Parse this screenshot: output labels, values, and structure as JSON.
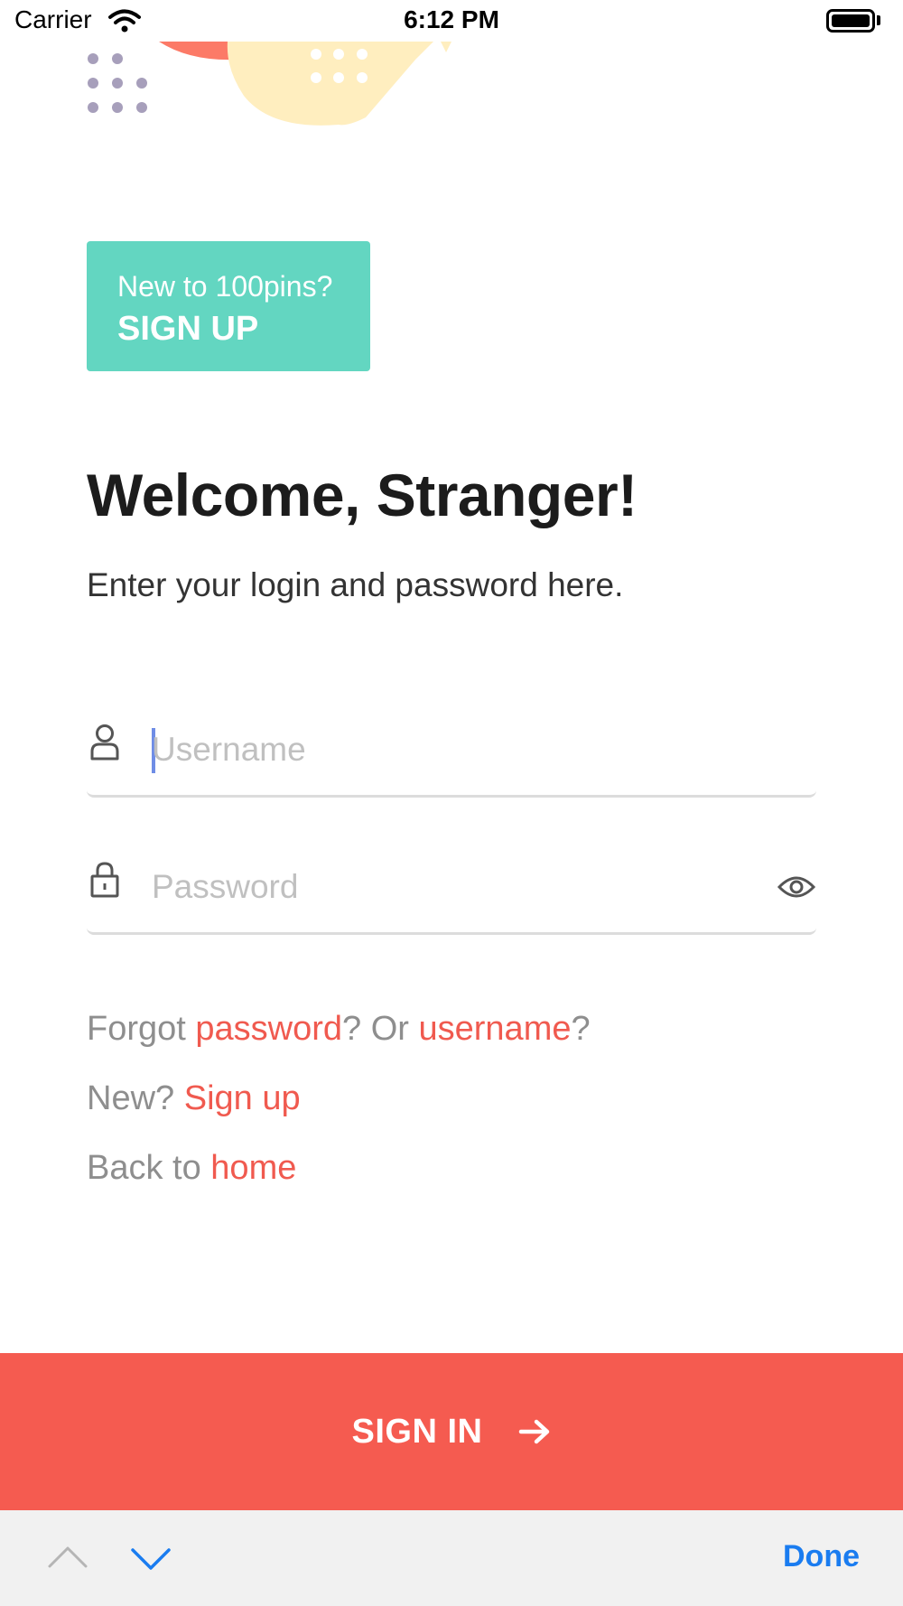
{
  "status_bar": {
    "carrier": "Carrier",
    "time": "6:12 PM",
    "icons": [
      "wifi-icon",
      "battery-icon"
    ]
  },
  "colors": {
    "accent_red": "#f55b50",
    "teal": "#63d6c1",
    "link_red": "#f05a4f",
    "toolbar_blue": "#1a7cf0"
  },
  "signup_card": {
    "prompt": "New to 100pins?",
    "cta": "SIGN UP"
  },
  "welcome": {
    "title": "Welcome, Stranger!",
    "subtitle": "Enter your login and password here."
  },
  "form": {
    "username": {
      "placeholder": "Username",
      "value": "",
      "icon": "user-icon"
    },
    "password": {
      "placeholder": "Password",
      "value": "",
      "icon": "lock-icon",
      "toggle_icon": "eye-icon"
    }
  },
  "links": {
    "forgot_prefix": "Forgot ",
    "forgot_password": "password",
    "forgot_middle": "? Or ",
    "forgot_username": "username",
    "forgot_suffix": "?",
    "new_prefix": "New? ",
    "signup": "Sign up",
    "back_prefix": "Back to ",
    "home": "home"
  },
  "signin_button": {
    "label": "SIGN IN",
    "icon": "arrow-right-icon"
  },
  "keyboard_toolbar": {
    "prev_icon": "chevron-up-icon",
    "next_icon": "chevron-down-icon",
    "done": "Done"
  }
}
